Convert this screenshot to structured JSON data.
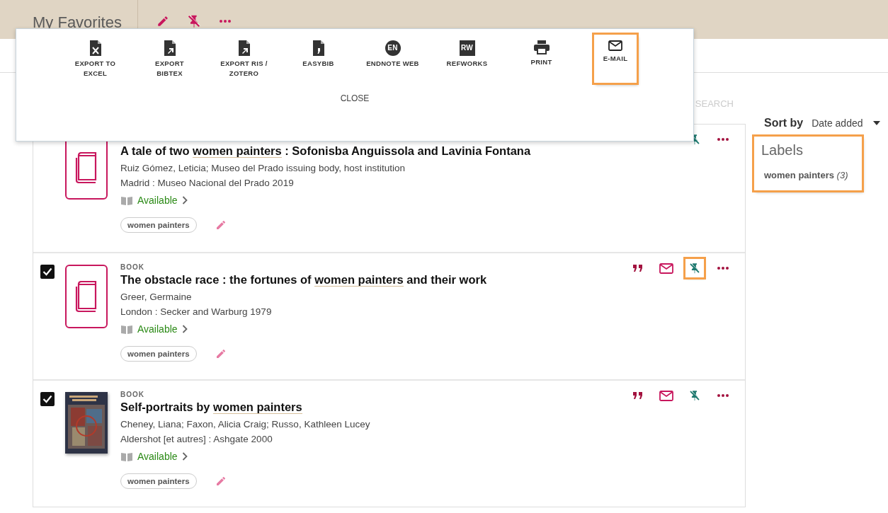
{
  "header": {
    "title": "My Favorites"
  },
  "export_menu": {
    "items": [
      {
        "kind": "excel",
        "label": "EXPORT TO EXCEL",
        "highlighted": false
      },
      {
        "kind": "bibtex",
        "label": "EXPORT BIBTEX",
        "highlighted": false
      },
      {
        "kind": "ris",
        "label": "EXPORT RIS / ZOTERO",
        "highlighted": false
      },
      {
        "kind": "easybib",
        "label": "EASYBIB",
        "highlighted": false
      },
      {
        "kind": "endnote",
        "badge": "EN",
        "label": "ENDNOTE WEB",
        "highlighted": false
      },
      {
        "kind": "refworks",
        "badge": "RW",
        "label": "REFWORKS",
        "highlighted": false
      },
      {
        "kind": "print",
        "label": "PRINT",
        "highlighted": false
      },
      {
        "kind": "email",
        "label": "E-MAIL",
        "highlighted": true
      }
    ],
    "close": "CLOSE"
  },
  "search": {
    "label": "SEARCH"
  },
  "sort": {
    "label": "Sort by",
    "value": "Date added"
  },
  "labels": {
    "title": "Labels",
    "highlighted": true,
    "items": [
      {
        "name": "women painters",
        "count": "(3)"
      }
    ]
  },
  "results": [
    {
      "cover": {
        "kind": "icon"
      },
      "title": [
        {
          "text": "A tale of two ",
          "match": false
        },
        {
          "text": "women painters",
          "match": true
        },
        {
          "text": " : Sofonisba Anguissola and Lavinia Fontana",
          "match": false
        }
      ],
      "authors": "Ruiz Gómez, Leticia; Museo del Prado issuing body, host institution",
      "publisher": "Madrid : Museo Nacional del Prado 2019",
      "availability": "Available",
      "tag": "women painters",
      "actions": [
        {
          "kind": "pin",
          "highlighted": false
        },
        {
          "kind": "more",
          "highlighted": false
        }
      ]
    },
    {
      "checked": true,
      "cover": {
        "kind": "icon"
      },
      "type": "BOOK",
      "title": [
        {
          "text": "The obstacle race : the fortunes of ",
          "match": false
        },
        {
          "text": "women painters",
          "match": true
        },
        {
          "text": " and their work",
          "match": false
        }
      ],
      "authors": "Greer, Germaine",
      "publisher": "London : Secker and Warburg 1979",
      "availability": "Available",
      "tag": "women painters",
      "actions": [
        {
          "kind": "cite",
          "highlighted": false
        },
        {
          "kind": "email",
          "highlighted": false
        },
        {
          "kind": "pin",
          "highlighted": true
        },
        {
          "kind": "more",
          "highlighted": false
        }
      ]
    },
    {
      "checked": true,
      "cover": {
        "kind": "picture"
      },
      "type": "BOOK",
      "title": [
        {
          "text": "Self-portraits by ",
          "match": false
        },
        {
          "text": "women painters",
          "match": true
        }
      ],
      "authors": "Cheney, Liana; Faxon, Alicia Craig; Russo, Kathleen Lucey",
      "publisher": "Aldershot [et autres] : Ashgate 2000",
      "availability": "Available",
      "tag": "women painters",
      "actions": [
        {
          "kind": "cite",
          "highlighted": false
        },
        {
          "kind": "email",
          "highlighted": false
        },
        {
          "kind": "pin",
          "highlighted": false
        },
        {
          "kind": "more",
          "highlighted": false
        }
      ]
    }
  ]
}
